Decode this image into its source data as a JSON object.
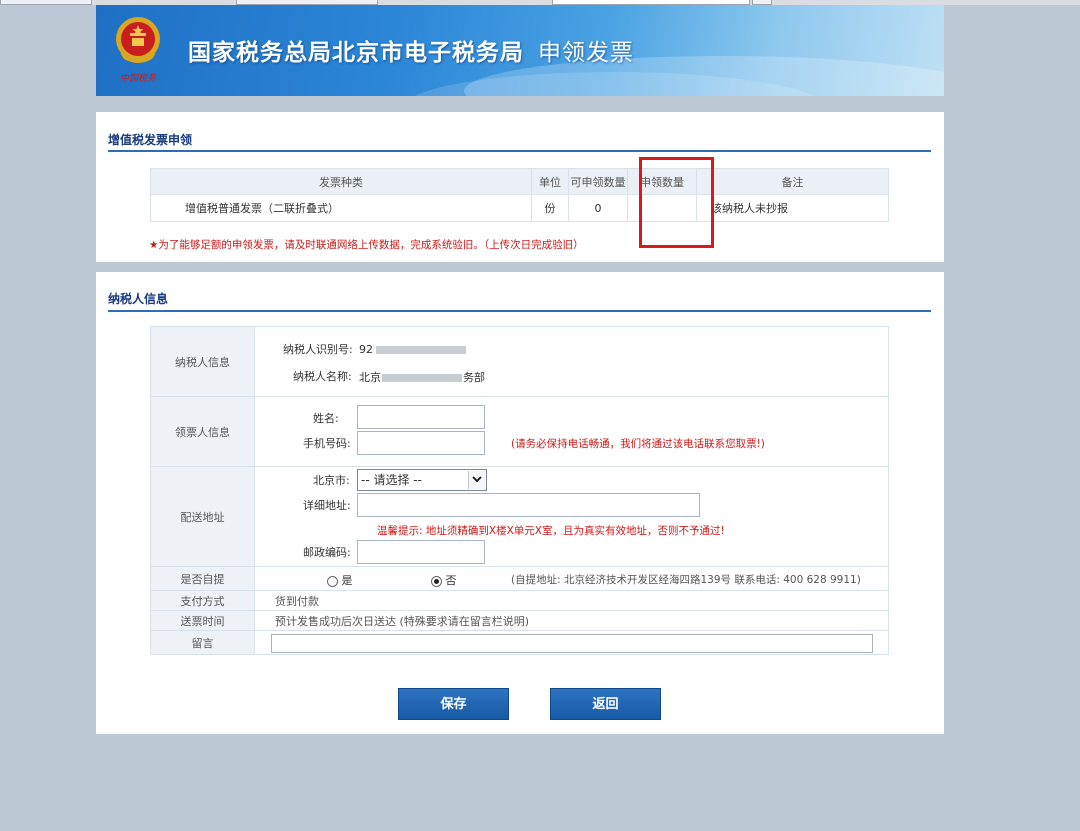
{
  "header": {
    "title": "国家税务总局北京市电子税务局",
    "subtitle": "申领发票",
    "emblem_caption": "中国税务"
  },
  "invoice_section": {
    "title": "增值税发票申领",
    "columns": [
      "发票种类",
      "单位",
      "可申领数量",
      "申领数量",
      "备注"
    ],
    "row": {
      "type": "增值税普通发票（二联折叠式）",
      "unit": "份",
      "available": "0",
      "requested": "",
      "note": "该纳税人未抄报"
    },
    "warning": "★为了能够足额的申领发票，请及时联通网络上传数据，完成系统验旧。（上传次日完成验旧）"
  },
  "taxpayer_section": {
    "title": "纳税人信息",
    "taxpayer_info": {
      "label": "纳税人信息",
      "id_label": "纳税人识别号:",
      "id_value_prefix": "92",
      "name_label": "纳税人名称:",
      "name_prefix": "北京",
      "name_suffix": "务部"
    },
    "recipient_info": {
      "label": "领票人信息",
      "name_label": "姓名:",
      "name_value": "",
      "phone_label": "手机号码:",
      "phone_value": "",
      "phone_hint": "(请务必保持电话畅通，我们将通过该电话联系您取票!)"
    },
    "delivery": {
      "label": "配送地址",
      "city_label": "北京市:",
      "city_selected": "-- 请选择 --",
      "detail_label": "详细地址:",
      "detail_value": "",
      "tip": "温馨提示: 地址须精确到X楼X单元X室，且为真实有效地址，否则不予通过!",
      "postcode_label": "邮政编码:",
      "postcode_value": ""
    },
    "self_pickup": {
      "label": "是否自提",
      "option_yes": "是",
      "option_no": "否",
      "selected": "否",
      "info": "(自提地址: 北京经济技术开发区经海四路139号 联系电话: 400 628 9911)"
    },
    "payment": {
      "label": "支付方式",
      "value": "货到付款"
    },
    "delivery_time": {
      "label": "送票时间",
      "value": "预计发售成功后次日送达 (特殊要求请在留言栏说明)"
    },
    "message": {
      "label": "留言",
      "value": ""
    }
  },
  "buttons": {
    "save": "保存",
    "back": "返回"
  },
  "colors": {
    "highlight_box": "#d71a1a",
    "button": "#1f64b0",
    "warning_text": "#d01818",
    "section_title": "#1a3d82"
  }
}
